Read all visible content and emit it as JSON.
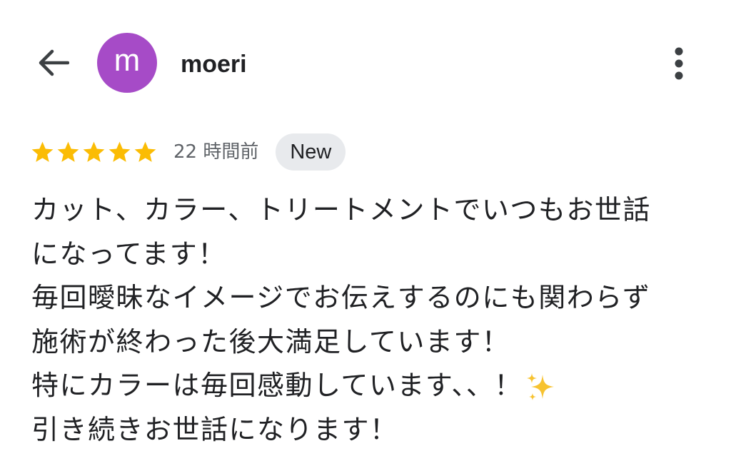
{
  "header": {
    "back_icon": "arrow-back-icon",
    "avatar_letter": "m",
    "avatar_color": "#a64bc7",
    "username": "moeri",
    "more_icon": "more-vert-icon"
  },
  "review": {
    "rating": 5,
    "max_rating": 5,
    "star_color": "#fbbc04",
    "time": "22 時間前",
    "badge": "New",
    "lines": [
      "カット、カラー、トリートメントでいつもお世話",
      "になってます！",
      "毎回曖昧なイメージでお伝えするのにも関わらず",
      "施術が終わった後大満足しています！",
      "特にカラーは毎回感動しています、、！",
      "引き続きお世話になります！"
    ],
    "emoji": "sparkles-icon"
  }
}
